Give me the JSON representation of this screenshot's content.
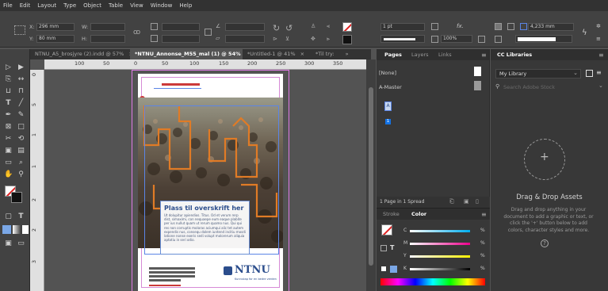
{
  "menu": [
    "File",
    "Edit",
    "Layout",
    "Type",
    "Object",
    "Table",
    "View",
    "Window",
    "Help"
  ],
  "control": {
    "x_label": "X:",
    "x_value": "296 mm",
    "y_label": "Y:",
    "y_value": "80 mm",
    "w_label": "W:",
    "h_label": "H:",
    "stroke_weight": "1 pt",
    "opacity": "100%",
    "width_value": "4,233 mm"
  },
  "tabs": [
    {
      "label": "NTNU_A5_brosjyre (2).indd @ 57%",
      "close": "×"
    },
    {
      "label": "*NTNU_Annonse_M55_mal (1) @ 54%",
      "close": "×"
    },
    {
      "label": "*Untitled-1 @ 41%",
      "close": "×"
    },
    {
      "label": "*Til try:",
      "close": "»"
    }
  ],
  "ruler_h": [
    "100",
    "50",
    "0",
    "50",
    "100",
    "150",
    "200",
    "250",
    "300",
    "350"
  ],
  "ruler_v": [
    "0",
    "5",
    "1",
    "1",
    "2",
    "2",
    "3"
  ],
  "document": {
    "headline": "Plass til overskrift her",
    "body": "Ut dolupitur apiendios. Titus. Od et verum rerp dist, simaximi, con nequaepe eum eaque plabite per ius nullut quam ut rerum quamo nus. Qui qui res non corruptis moloras aciumqui alic tet autem expendis nus, consequ dolem iuntend incitiu mosdi latione nonse exeris sedi volupt molorerum aliquia aptatiu in seri odio.",
    "logo_text": "NTNU",
    "logo_sub": "Kunnskap for en bedre verden"
  },
  "pages_panel": {
    "tabs": [
      "Pages",
      "Layers",
      "Links"
    ],
    "none": "[None]",
    "master": "A-Master",
    "page_letter": "A",
    "page_number": "1",
    "footer": "1 Page in 1 Spread"
  },
  "color_panel": {
    "tabs": [
      "Stroke",
      "Color"
    ],
    "channels": [
      {
        "name": "C",
        "pct": "%"
      },
      {
        "name": "M",
        "pct": "%"
      },
      {
        "name": "Y",
        "pct": "%"
      },
      {
        "name": "K",
        "pct": "%"
      }
    ],
    "t_label": "T"
  },
  "lib_panel": {
    "title": "CC Libraries",
    "library": "My Library",
    "search_placeholder": "Search Adobe Stock",
    "dd_title": "Drag & Drop Assets",
    "dd_text": "Drag and drop anything in your document to add a graphic or text, or click the '+' button below to add colors, character styles and more.",
    "plus": "+"
  },
  "colors": {
    "accent_orange": "#e07b26",
    "ntnu_blue": "#2b4d8c",
    "frame_blue": "#5b85e6"
  }
}
